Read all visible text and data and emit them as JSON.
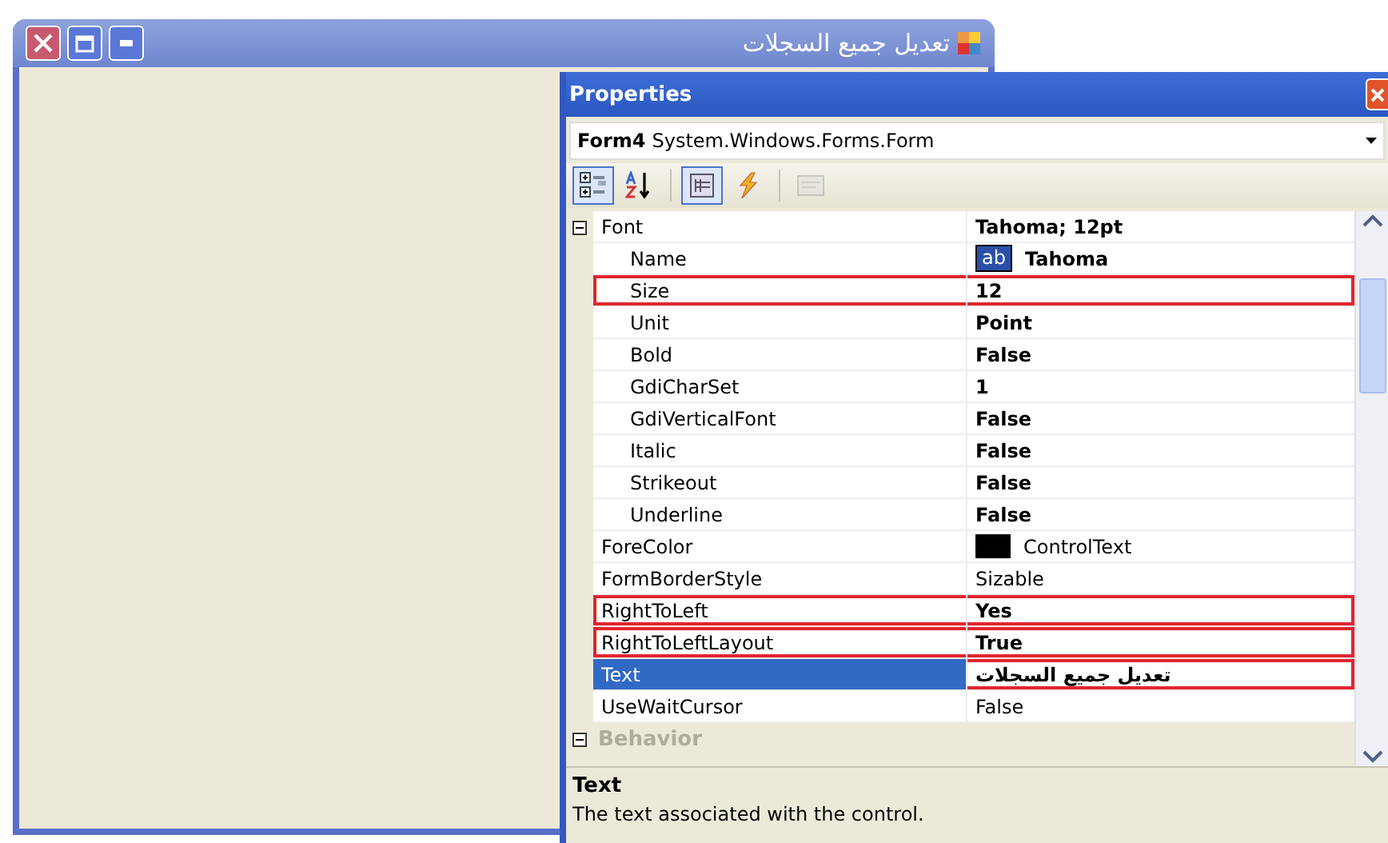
{
  "form": {
    "title": "تعديل جميع السجلات"
  },
  "properties": {
    "title": "Properties",
    "object_name": "Form4",
    "object_type": "System.Windows.Forms.Form",
    "toolbar": [
      {
        "kind": "categorized",
        "selected": true,
        "disabled": false
      },
      {
        "kind": "alphabetical",
        "selected": false,
        "disabled": false
      },
      {
        "kind": "properties",
        "selected": true,
        "disabled": false
      },
      {
        "kind": "events",
        "selected": false,
        "disabled": false
      },
      {
        "kind": "pages",
        "selected": false,
        "disabled": true
      }
    ],
    "rows": [
      {
        "kind": "property",
        "name": "Font",
        "value": "Tahoma; 12pt",
        "bold": true,
        "highlighted": false,
        "selected": false,
        "expanded": true,
        "children": [
          {
            "kind": "property",
            "name": "Name",
            "value": "Tahoma",
            "preview": "ab",
            "bold": true,
            "highlighted": false,
            "selected": false
          },
          {
            "kind": "property",
            "name": "Size",
            "value": "12",
            "bold": true,
            "highlighted": true,
            "selected": false
          },
          {
            "kind": "property",
            "name": "Unit",
            "value": "Point",
            "bold": true,
            "highlighted": false,
            "selected": false
          },
          {
            "kind": "property",
            "name": "Bold",
            "value": "False",
            "bold": true,
            "highlighted": false,
            "selected": false
          },
          {
            "kind": "property",
            "name": "GdiCharSet",
            "value": "1",
            "bold": true,
            "highlighted": false,
            "selected": false
          },
          {
            "kind": "property",
            "name": "GdiVerticalFont",
            "value": "False",
            "bold": true,
            "highlighted": false,
            "selected": false
          },
          {
            "kind": "property",
            "name": "Italic",
            "value": "False",
            "bold": true,
            "highlighted": false,
            "selected": false
          },
          {
            "kind": "property",
            "name": "Strikeout",
            "value": "False",
            "bold": true,
            "highlighted": false,
            "selected": false
          },
          {
            "kind": "property",
            "name": "Underline",
            "value": "False",
            "bold": true,
            "highlighted": false,
            "selected": false
          }
        ]
      },
      {
        "kind": "property",
        "name": "ForeColor",
        "value": "ControlText",
        "color": "#000000",
        "bold": false,
        "highlighted": false,
        "selected": false
      },
      {
        "kind": "property",
        "name": "FormBorderStyle",
        "value": "Sizable",
        "bold": false,
        "highlighted": false,
        "selected": false
      },
      {
        "kind": "property",
        "name": "RightToLeft",
        "value": "Yes",
        "bold": true,
        "highlighted": true,
        "selected": false
      },
      {
        "kind": "property",
        "name": "RightToLeftLayout",
        "value": "True",
        "bold": true,
        "highlighted": true,
        "selected": false
      },
      {
        "kind": "property",
        "name": "Text",
        "value": "تعديل جميع السجلات",
        "bold": true,
        "highlighted": true,
        "selected": true
      },
      {
        "kind": "property",
        "name": "UseWaitCursor",
        "value": "False",
        "bold": false,
        "highlighted": false,
        "selected": false
      },
      {
        "kind": "category",
        "name": "Behavior",
        "expanded": true
      }
    ],
    "description": {
      "title": "Text",
      "text": "The text associated with the control."
    }
  }
}
